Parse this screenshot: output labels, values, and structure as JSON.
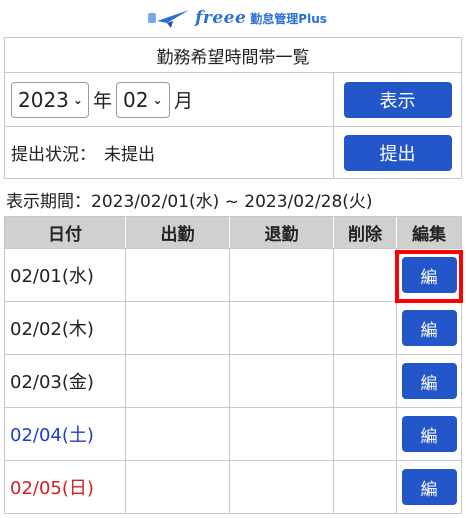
{
  "header": {
    "brand_wordmark": "freee",
    "brand_product": "勤怠管理Plus"
  },
  "page_title": "勤務希望時間帯一覧",
  "filter": {
    "year_value": "2023",
    "year_unit": "年",
    "month_value": "02",
    "month_unit": "月",
    "show_button": "表示"
  },
  "status": {
    "label": "提出状況：",
    "value": "未提出",
    "submit_button": "提出"
  },
  "period": {
    "text": "表示期間：2023/02/01(水) ~ 2023/02/28(火)"
  },
  "table": {
    "headers": [
      "日付",
      "出勤",
      "退勤",
      "削除",
      "編集"
    ],
    "edit_label": "編",
    "rows": [
      {
        "date": "02/01(水)",
        "in": "",
        "out": ""
      },
      {
        "date": "02/02(木)",
        "in": "",
        "out": ""
      },
      {
        "date": "02/03(金)",
        "in": "",
        "out": ""
      },
      {
        "date": "02/04(土)",
        "in": "",
        "out": ""
      },
      {
        "date": "02/05(日)",
        "in": "",
        "out": ""
      }
    ]
  },
  "colors": {
    "primary": "#2357c9",
    "saturday": "#1f3ccc",
    "sunday": "#d42020",
    "highlight": "#ff0000"
  }
}
